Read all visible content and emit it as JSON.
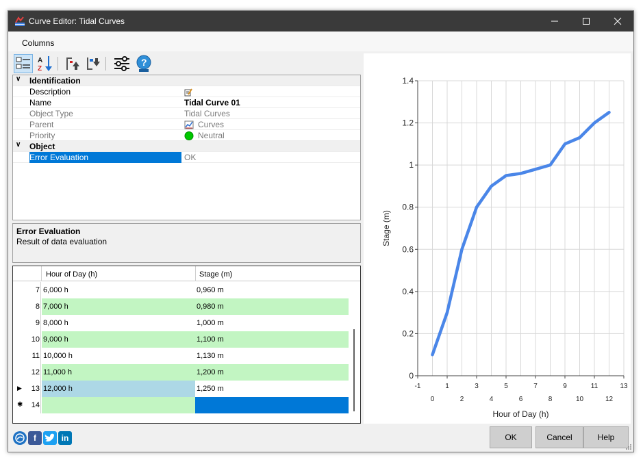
{
  "window": {
    "title": "Curve Editor: Tidal Curves"
  },
  "menu": {
    "columns_label": "Columns"
  },
  "properties": {
    "identification_label": "Identification",
    "object_label": "Object",
    "rows": {
      "description": {
        "name": "Description",
        "value": ""
      },
      "name": {
        "name": "Name",
        "value": "Tidal Curve 01"
      },
      "object_type": {
        "name": "Object Type",
        "value": "Tidal Curves"
      },
      "parent": {
        "name": "Parent",
        "value": "Curves"
      },
      "priority": {
        "name": "Priority",
        "value": "Neutral",
        "status_color": "#00c800"
      },
      "error_evaluation": {
        "name": "Error Evaluation",
        "value": "OK"
      }
    }
  },
  "description_panel": {
    "title": "Error Evaluation",
    "text": "Result of data evaluation"
  },
  "table": {
    "headers": {
      "hour": "Hour of Day (h)",
      "stage": "Stage (m)"
    },
    "rows": [
      {
        "index": "7",
        "hour": "6,000 h",
        "stage": "0,960 m"
      },
      {
        "index": "8",
        "hour": "7,000 h",
        "stage": "0,980 m"
      },
      {
        "index": "9",
        "hour": "8,000 h",
        "stage": "1,000 m"
      },
      {
        "index": "10",
        "hour": "9,000 h",
        "stage": "1,100 m"
      },
      {
        "index": "11",
        "hour": "10,000 h",
        "stage": "1,130 m"
      },
      {
        "index": "12",
        "hour": "11,000 h",
        "stage": "1,200 m"
      },
      {
        "index": "13",
        "hour": "12,000 h",
        "stage": "1,250 m"
      },
      {
        "index": "14",
        "hour": "",
        "stage": ""
      }
    ]
  },
  "buttons": {
    "ok": "OK",
    "cancel": "Cancel",
    "help": "Help"
  },
  "social": {
    "facebook": "f",
    "linkedin": "in"
  },
  "chart_data": {
    "type": "line",
    "title": "",
    "xlabel": "Hour of Day (h)",
    "ylabel": "Stage (m)",
    "xlim": [
      -1,
      13
    ],
    "ylim": [
      0,
      1.4
    ],
    "grid": true,
    "x_ticks_upper": [
      "-1",
      "1",
      "3",
      "5",
      "7",
      "9",
      "11",
      "13"
    ],
    "x_ticks_lower": [
      "0",
      "2",
      "4",
      "6",
      "8",
      "10",
      "12"
    ],
    "y_ticks": [
      "0",
      "0.2",
      "0.4",
      "0.6",
      "0.8",
      "1",
      "1.2",
      "1.4"
    ],
    "series": [
      {
        "color": "#4a86e8",
        "x": [
          0,
          1,
          2,
          3,
          4,
          5,
          6,
          7,
          8,
          9,
          10,
          11,
          12
        ],
        "y": [
          0.1,
          0.3,
          0.6,
          0.8,
          0.9,
          0.95,
          0.96,
          0.98,
          1.0,
          1.1,
          1.13,
          1.2,
          1.25
        ]
      }
    ]
  }
}
